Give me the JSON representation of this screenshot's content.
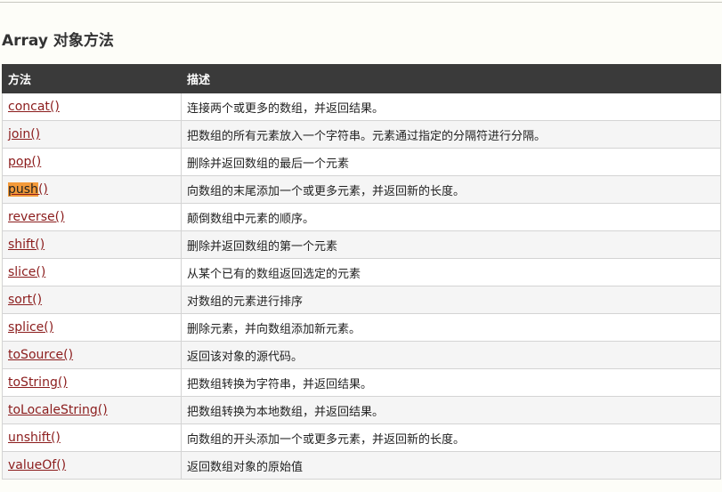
{
  "page": {
    "title": "Array 对象方法"
  },
  "table": {
    "headers": [
      "方法",
      "描述"
    ],
    "rows": [
      {
        "method": "concat()",
        "description": "连接两个或更多的数组，并返回结果。"
      },
      {
        "method": "join()",
        "description": "把数组的所有元素放入一个字符串。元素通过指定的分隔符进行分隔。"
      },
      {
        "method": "pop()",
        "description": "删除并返回数组的最后一个元素"
      },
      {
        "method": "push()",
        "method_highlight": "push",
        "method_rest": "()",
        "description": "向数组的末尾添加一个或更多元素，并返回新的长度。"
      },
      {
        "method": "reverse()",
        "description": "颠倒数组中元素的顺序。"
      },
      {
        "method": "shift()",
        "description": "删除并返回数组的第一个元素"
      },
      {
        "method": "slice()",
        "description": "从某个已有的数组返回选定的元素"
      },
      {
        "method": "sort()",
        "description": "对数组的元素进行排序"
      },
      {
        "method": "splice()",
        "description": "删除元素，并向数组添加新元素。"
      },
      {
        "method": "toSource()",
        "description": "返回该对象的源代码。"
      },
      {
        "method": "toString()",
        "description": "把数组转换为字符串，并返回结果。"
      },
      {
        "method": "toLocaleString()",
        "description": "把数组转换为本地数组，并返回结果。"
      },
      {
        "method": "unshift()",
        "description": "向数组的开头添加一个或更多元素，并返回新的长度。"
      },
      {
        "method": "valueOf()",
        "description": "返回数组对象的原始值"
      }
    ]
  },
  "colors": {
    "header_bg": "#3a3a3a",
    "link": "#8b1c1c",
    "highlight": "#f39a3a"
  }
}
